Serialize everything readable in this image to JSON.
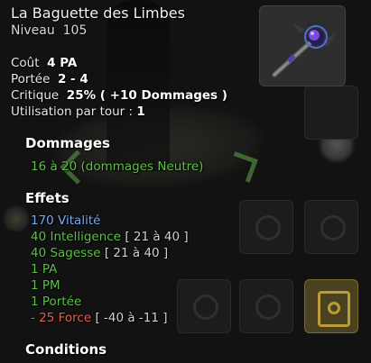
{
  "item": {
    "name": "La Baguette des Limbes",
    "level_label": "Niveau",
    "level_value": "105"
  },
  "stats": {
    "cost_label": "Coût",
    "cost_value": "4 PA",
    "range_label": "Portée",
    "range_value": "2 - 4",
    "critical_label": "Critique",
    "critical_value": "25% ( +10 Dommages )",
    "uses_label": "Utilisation par tour :",
    "uses_value": "1"
  },
  "damage": {
    "heading": "Dommages",
    "line": "16 à 20 (dommages Neutre)"
  },
  "effects": {
    "heading": "Effets",
    "items": [
      {
        "text": "170 Vitalité",
        "range": "",
        "color": "#7aa9e8"
      },
      {
        "text": "40 Intelligence",
        "range": "[ 21 à 40 ]",
        "color": "#5fbf4a"
      },
      {
        "text": "40 Sagesse",
        "range": "[ 21 à 40 ]",
        "color": "#5fbf4a"
      },
      {
        "text": "1 PA",
        "range": "",
        "color": "#5fbf4a"
      },
      {
        "text": "1 PM",
        "range": "",
        "color": "#5fbf4a"
      },
      {
        "text": "1 Portée",
        "range": "",
        "color": "#5fbf4a"
      },
      {
        "text": "- 25 Force",
        "range": "[ -40 à -11 ]",
        "color": "#e0604f"
      }
    ]
  },
  "conditions": {
    "heading": "Conditions"
  },
  "icons": {
    "item_image": "wand-icon"
  }
}
